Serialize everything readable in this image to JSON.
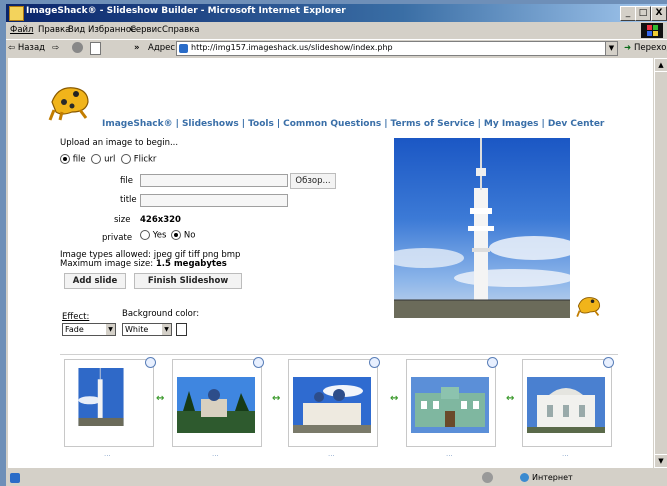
{
  "window": {
    "title": "ImageShack® - Slideshow Builder - Microsoft Internet Explorer",
    "min": "_",
    "max": "□",
    "close": "X"
  },
  "menu": [
    "Файл",
    "Правка",
    "Вид",
    "Избранное",
    "Сервис",
    "Справка"
  ],
  "toolbar": {
    "back": "⇦ Назад",
    "forward": "⇨",
    "address_label": "Адрес",
    "address_value": "http://img157.imageshack.us/slideshow/index.php",
    "go": "Переход",
    "more": "»"
  },
  "nav": [
    "ImageShack®",
    "Slideshows",
    "Tools",
    "Common Questions",
    "Terms of Service",
    "My Images",
    "Dev Center"
  ],
  "nav_sep": "|",
  "upload": {
    "heading": "Upload an image to begin...",
    "source_options": [
      "file",
      "url",
      "Flickr"
    ],
    "file_label": "file",
    "browse": "Обзор...",
    "title_label": "title",
    "size_label": "size",
    "size_value": "426x320",
    "private_label": "private",
    "private_options": [
      "Yes",
      "No"
    ],
    "types_label": "Image types allowed: jpeg gif tiff png bmp",
    "max_size_label": "Maximum image size:",
    "max_size_value": "1.5 megabytes",
    "add_slide": "Add slide",
    "finish": "Finish Slideshow"
  },
  "effect": {
    "effect_label": "Effect:",
    "effect_value": "Fade",
    "bg_label": "Background color:",
    "bg_value": "White"
  },
  "status": {
    "zone": "Интернет"
  },
  "slides": [
    {
      "name": "tower"
    },
    {
      "name": "church-complex"
    },
    {
      "name": "monastery"
    },
    {
      "name": "green-building"
    },
    {
      "name": "white-building"
    }
  ],
  "slide_caption": "...",
  "colors": {
    "nav": "#3a6fa8",
    "title_gradient_start": "#0a246a",
    "arrow_green": "#3e9b2f"
  }
}
